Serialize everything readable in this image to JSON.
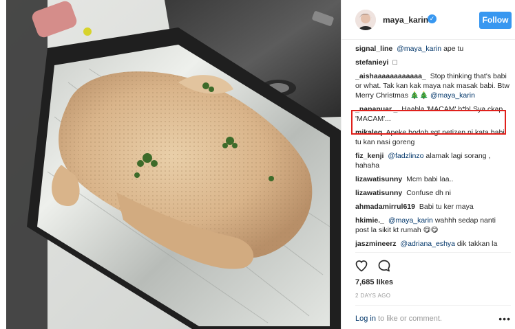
{
  "post": {
    "username": "maya_karin",
    "follow_label": "Follow",
    "likes": "7,685 likes",
    "date": "2 DAYS AGO",
    "login_link": "Log in",
    "login_rest": " to like or comment.",
    "more": "•••"
  },
  "comments": [
    {
      "user": "signal_line",
      "mention": "@maya_karin",
      "text": " ape tu"
    },
    {
      "user": "stefanieyi",
      "mention": "",
      "text": "□"
    },
    {
      "user": "_aishaaaaaaaaaaaa_",
      "mention": "",
      "text": "Stop thinking that's babi or what. Tak kan kak maya nak masak babi. Btw Merry Christmas 🎄🎄",
      "tail_mention": "@maya_karin"
    },
    {
      "user": "_nananuar._",
      "mention": "",
      "text": "Haahla 'MACAM' b*b! Sya ckap 'MACAM'..."
    },
    {
      "user": "mikaleq",
      "mention": "",
      "text": "Apeke bodoh sgt netizen ni kata babi tu kan nasi goreng"
    },
    {
      "user": "fiz_kenji",
      "mention": "@fadzlinzo",
      "text": " alamak lagi sorang , hahaha"
    },
    {
      "user": "lizawatisunny",
      "mention": "",
      "text": "Mcm babi laa.."
    },
    {
      "user": "lizawatisunny",
      "mention": "",
      "text": "Confuse dh ni"
    },
    {
      "user": "ahmadamirrul619",
      "mention": "",
      "text": "Babi tu ker maya"
    },
    {
      "user": "hkimie._",
      "mention": "@maya_karin",
      "text": " wahhh sedap nanti post la sikit kt rumah 😋😋"
    },
    {
      "user": "jaszmineerz",
      "mention": "@adriana_eshya",
      "text": " dik takkan la"
    }
  ],
  "icons": {
    "heart": "heart-icon",
    "comment": "comment-icon",
    "verified": "verified-badge-icon"
  },
  "colors": {
    "accent": "#3897f0",
    "highlight": "#e0201b",
    "mention": "#003569"
  }
}
